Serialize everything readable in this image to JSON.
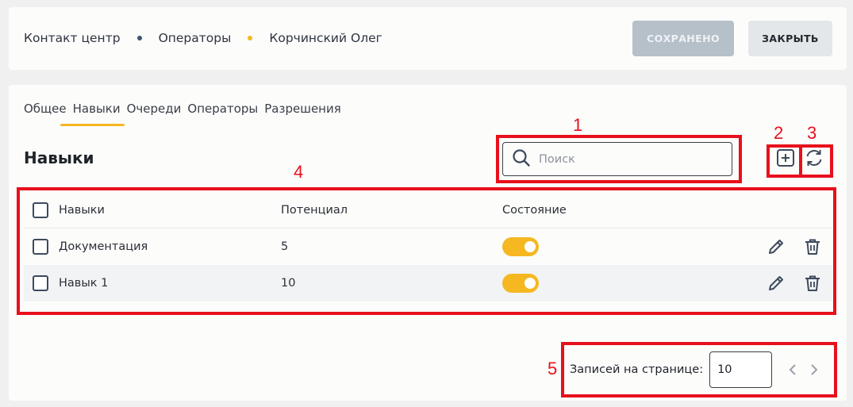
{
  "breadcrumb": {
    "level1": "Контакт центр",
    "level2": "Операторы",
    "level3": "Корчинский Олег"
  },
  "header_buttons": {
    "saved_label": "СОХРАНЕНО",
    "close_label": "ЗАКРЫТЬ"
  },
  "tabs": [
    {
      "label": "Общее",
      "active": false
    },
    {
      "label": "Навыки",
      "active": true
    },
    {
      "label": "Очереди",
      "active": false
    },
    {
      "label": "Операторы",
      "active": false
    },
    {
      "label": "Разрешения",
      "active": false
    }
  ],
  "section": {
    "title": "Навыки"
  },
  "search": {
    "placeholder": "Поиск",
    "value": ""
  },
  "table": {
    "columns": {
      "name": "Навыки",
      "potential": "Потенциал",
      "state": "Состояние"
    },
    "rows": [
      {
        "name": "Документация",
        "potential": "5",
        "enabled": true
      },
      {
        "name": "Навык 1",
        "potential": "10",
        "enabled": true
      }
    ]
  },
  "pagination": {
    "label": "Записей на странице:",
    "page_size": "10"
  },
  "annotations": {
    "n1": "1",
    "n2": "2",
    "n3": "3",
    "n4": "4",
    "n5": "5",
    "color": "#e8101c"
  },
  "colors": {
    "accent": "#f5b821",
    "saved_button": "#b5c0c9",
    "close_button": "#e4e7ea"
  },
  "icons": [
    "search-icon",
    "add-icon",
    "refresh-icon",
    "edit-icon",
    "trash-icon",
    "chevron-left-icon",
    "chevron-right-icon"
  ]
}
